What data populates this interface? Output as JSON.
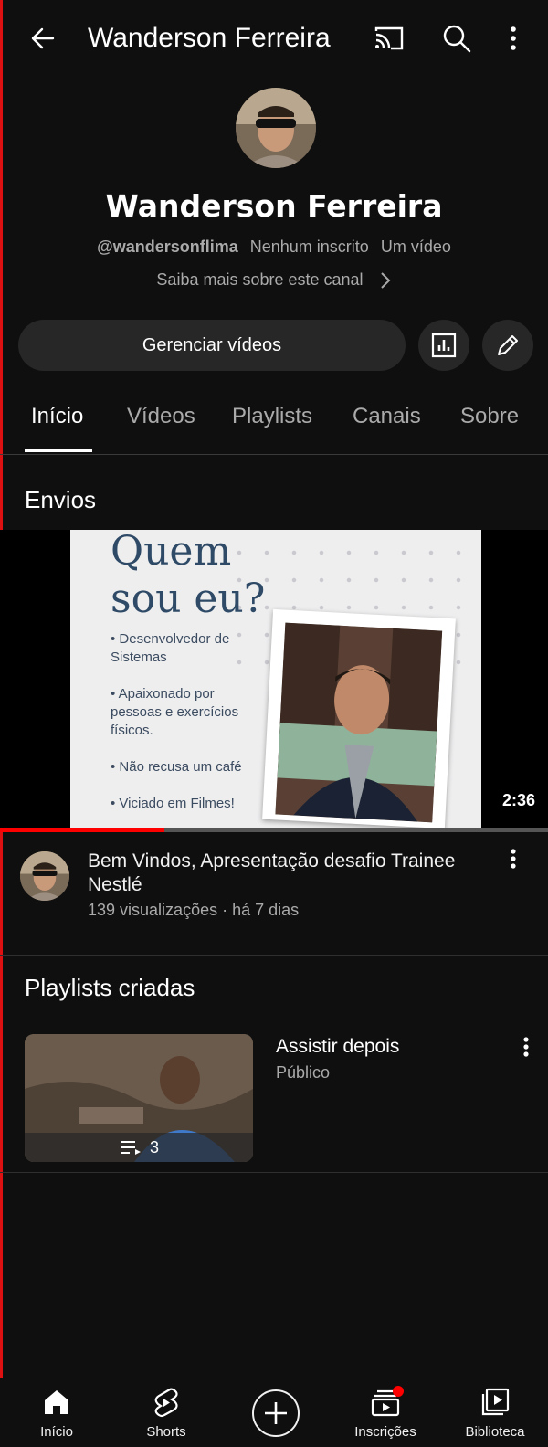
{
  "header": {
    "title": "Wanderson Ferreira",
    "icons": [
      "back-arrow-icon",
      "cast-icon",
      "search-icon",
      "more-vert-icon"
    ]
  },
  "channel": {
    "name": "Wanderson Ferreira",
    "handle": "@wandersonflima",
    "subscribers": "Nenhum inscrito",
    "video_count": "Um vídeo",
    "about_link": "Saiba mais sobre este canal",
    "manage_button": "Gerenciar vídeos"
  },
  "tabs": [
    {
      "label": "Início",
      "active": true
    },
    {
      "label": "Vídeos",
      "active": false
    },
    {
      "label": "Playlists",
      "active": false
    },
    {
      "label": "Canais",
      "active": false
    },
    {
      "label": "Sobre",
      "active": false
    }
  ],
  "uploads": {
    "section_title": "Envios",
    "video": {
      "thumbnail_text": {
        "line1": "Quem",
        "line2": "sou eu?",
        "bullets": [
          "• Desenvolvedor de Sistemas",
          "• Apaixonado por pessoas e exercícios físicos.",
          "• Não recusa um café",
          "• Viciado em Filmes!"
        ]
      },
      "duration": "2:36",
      "progress": 0.3,
      "title": "Bem Vindos, Apresentação desafio Trainee Nestlé",
      "meta": "139 visualizações · há 7 dias"
    }
  },
  "playlists": {
    "section_title": "Playlists criadas",
    "items": [
      {
        "name": "Assistir depois",
        "privacy": "Público",
        "count": "3"
      }
    ]
  },
  "bottom_nav": [
    {
      "label": "Início",
      "icon": "home-icon"
    },
    {
      "label": "Shorts",
      "icon": "shorts-icon"
    },
    {
      "label": "",
      "icon": "create-plus-icon"
    },
    {
      "label": "Inscrições",
      "icon": "subscriptions-icon"
    },
    {
      "label": "Biblioteca",
      "icon": "library-icon"
    }
  ],
  "colors": {
    "background": "#0f0f0f",
    "progress": "#ff0000",
    "notification_dot": "#ff0000"
  }
}
